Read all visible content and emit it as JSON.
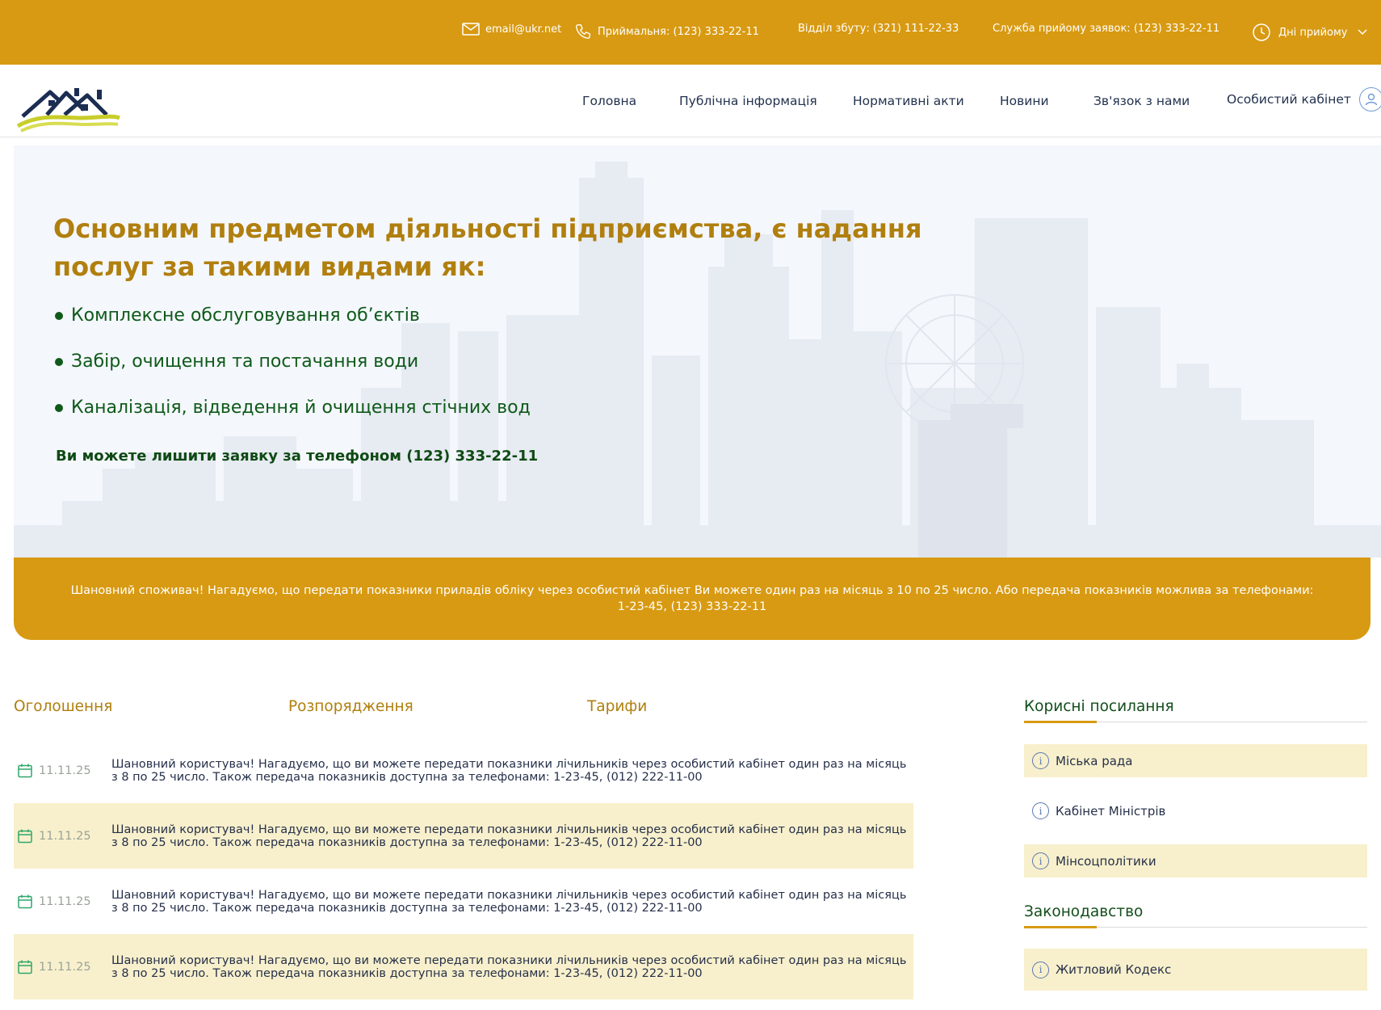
{
  "topbar": {
    "email": "email@ukr.net",
    "reception": "Приймальня: (123) 333-22-11",
    "sales": "Відділ збуту: (321) 111-22-33",
    "service": "Служба прийому заявок: (123) 333-22-11",
    "hours": "Дні прийому",
    "icons": [
      "mail-icon",
      "phone-icon",
      "clock-icon",
      "chevron-down-icon"
    ]
  },
  "nav": {
    "items": [
      "Головна",
      "Публічна інформація",
      "Нормативні акти",
      "Новини",
      "Зв'язок з нами"
    ],
    "cabinet": "Особистий кабінет"
  },
  "hero": {
    "title": "Основним предметом діяльності підприємства, є надання послуг за такими видами як:",
    "services": [
      "Комплексне обслуговування об’єктів",
      "Забір, очищення та постачання води",
      "Каналізація, відведення й очищення стічних вод"
    ],
    "call": "Ви можете лишити заявку за телефоном (123) 333-22-11"
  },
  "notice": {
    "text": "Шановний споживач! Нагадуємо, що передати показники приладів обліку через особистий кабінет Ви можете один раз на місяць з 10 по 25 число. Або передача показників можлива за телефонами: 1-23-45, (123) 333-22-11"
  },
  "tabs": [
    "Оголошення",
    "Розпорядження",
    "Тарифи"
  ],
  "news": [
    {
      "date": "11.11.25",
      "text": "Шановний користувач! Нагадуємо, що ви можете передати показники лічильників через особистий кабінет один раз на місяць з 8 по 25 число. Також передача показників доступна за телефонами: 1-23-45, (012) 222-11-00"
    },
    {
      "date": "11.11.25",
      "text": "Шановний користувач! Нагадуємо, що ви можете передати показники лічильників через особистий кабінет один раз на місяць з 8 по 25 число. Також передача показників доступна за телефонами: 1-23-45, (012) 222-11-00"
    },
    {
      "date": "11.11.25",
      "text": "Шановний користувач! Нагадуємо, що ви можете передати показники лічильників через особистий кабінет один раз на місяць з 8 по 25 число. Також передача показників доступна за телефонами: 1-23-45, (012) 222-11-00"
    },
    {
      "date": "11.11.25",
      "text": "Шановний користувач! Нагадуємо, що ви можете передати показники лічильників через особистий кабінет один раз на місяць з 8 по 25 число. Також передача показників доступна за телефонами: 1-23-45, (012) 222-11-00"
    }
  ],
  "sidebar": {
    "useful_title": "Корисні посилання",
    "useful_links": [
      "Міська рада",
      "Кабінет Міністрів",
      "Мінсоцполітики"
    ],
    "law_title": "Законодавство",
    "law_links": [
      "Житловий Кодекс"
    ]
  },
  "colors": {
    "accent": "#D89A12",
    "title_gold": "#B07F0E",
    "green": "#0f5a1a",
    "row_highlight": "#f8f0cc",
    "hero_bg": "#f4f7fc"
  }
}
